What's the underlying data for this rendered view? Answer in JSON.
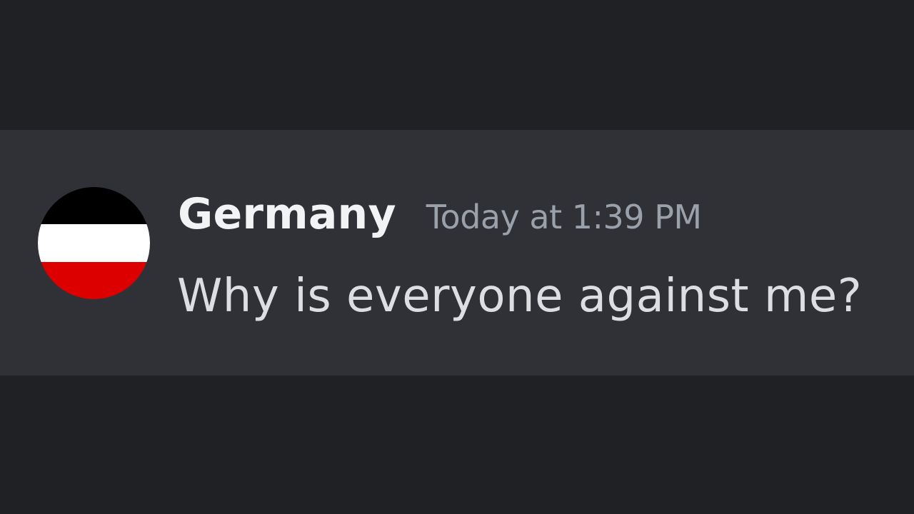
{
  "message": {
    "author": "Germany",
    "timestamp": "Today at 1:39 PM",
    "content": "Why is everyone against me?",
    "avatar": {
      "type": "flag",
      "stripes": [
        "#000000",
        "#ffffff",
        "#dd0000"
      ]
    }
  },
  "colors": {
    "background": "#1f2124",
    "message_highlight": "#303136",
    "username": "#f2f3f5",
    "timestamp": "#9ba1aa",
    "content": "#dcdee1"
  }
}
